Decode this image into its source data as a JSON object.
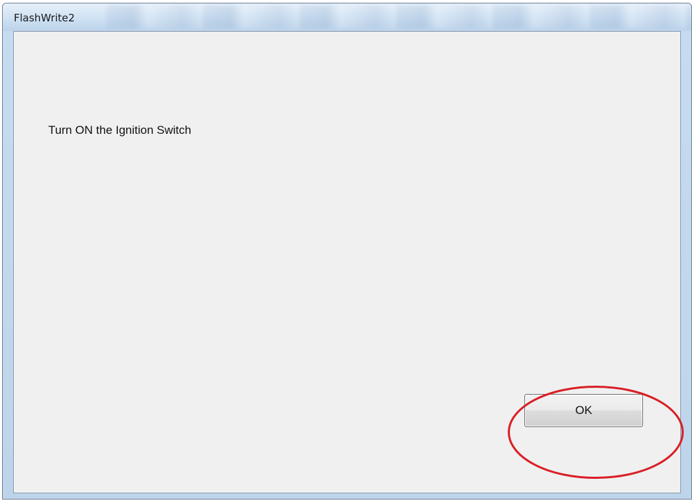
{
  "window": {
    "title": "FlashWrite2"
  },
  "dialog": {
    "message": "Turn ON the Ignition Switch",
    "ok_label": "OK"
  },
  "annotation": {
    "highlight_color": "#d91f26",
    "target": "ok-button"
  }
}
